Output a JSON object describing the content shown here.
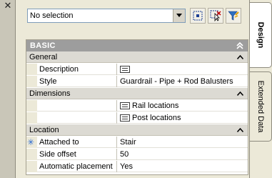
{
  "window": {
    "close_glyph": "✕"
  },
  "toolbar": {
    "selection_value": "No selection",
    "buttons": [
      {
        "icon": "quick-select-icon"
      },
      {
        "icon": "select-objects-icon"
      },
      {
        "icon": "filter-icon"
      }
    ]
  },
  "panel": {
    "basic_label": "BASIC",
    "groups": {
      "general": "General",
      "dimensions": "Dimensions",
      "location": "Location"
    },
    "rows": {
      "description_name": "Description",
      "style_name": "Style",
      "style_value": "Guardrail - Pipe + Rod Balusters",
      "rail_locations_value": "Rail locations",
      "post_locations_value": "Post locations",
      "attached_to_name": "Attached to",
      "attached_to_value": "Stair",
      "side_offset_name": "Side offset",
      "side_offset_value": "50",
      "automatic_placement_name": "Automatic placement",
      "automatic_placement_value": "Yes"
    }
  },
  "tabs": {
    "design": "Design",
    "extended_data": "Extended Data"
  },
  "colors": {
    "background": "#ece9d8",
    "header_gray": "#9d9d9d",
    "group_gray": "#dcdad3",
    "accent_blue": "#2a6ad0"
  }
}
